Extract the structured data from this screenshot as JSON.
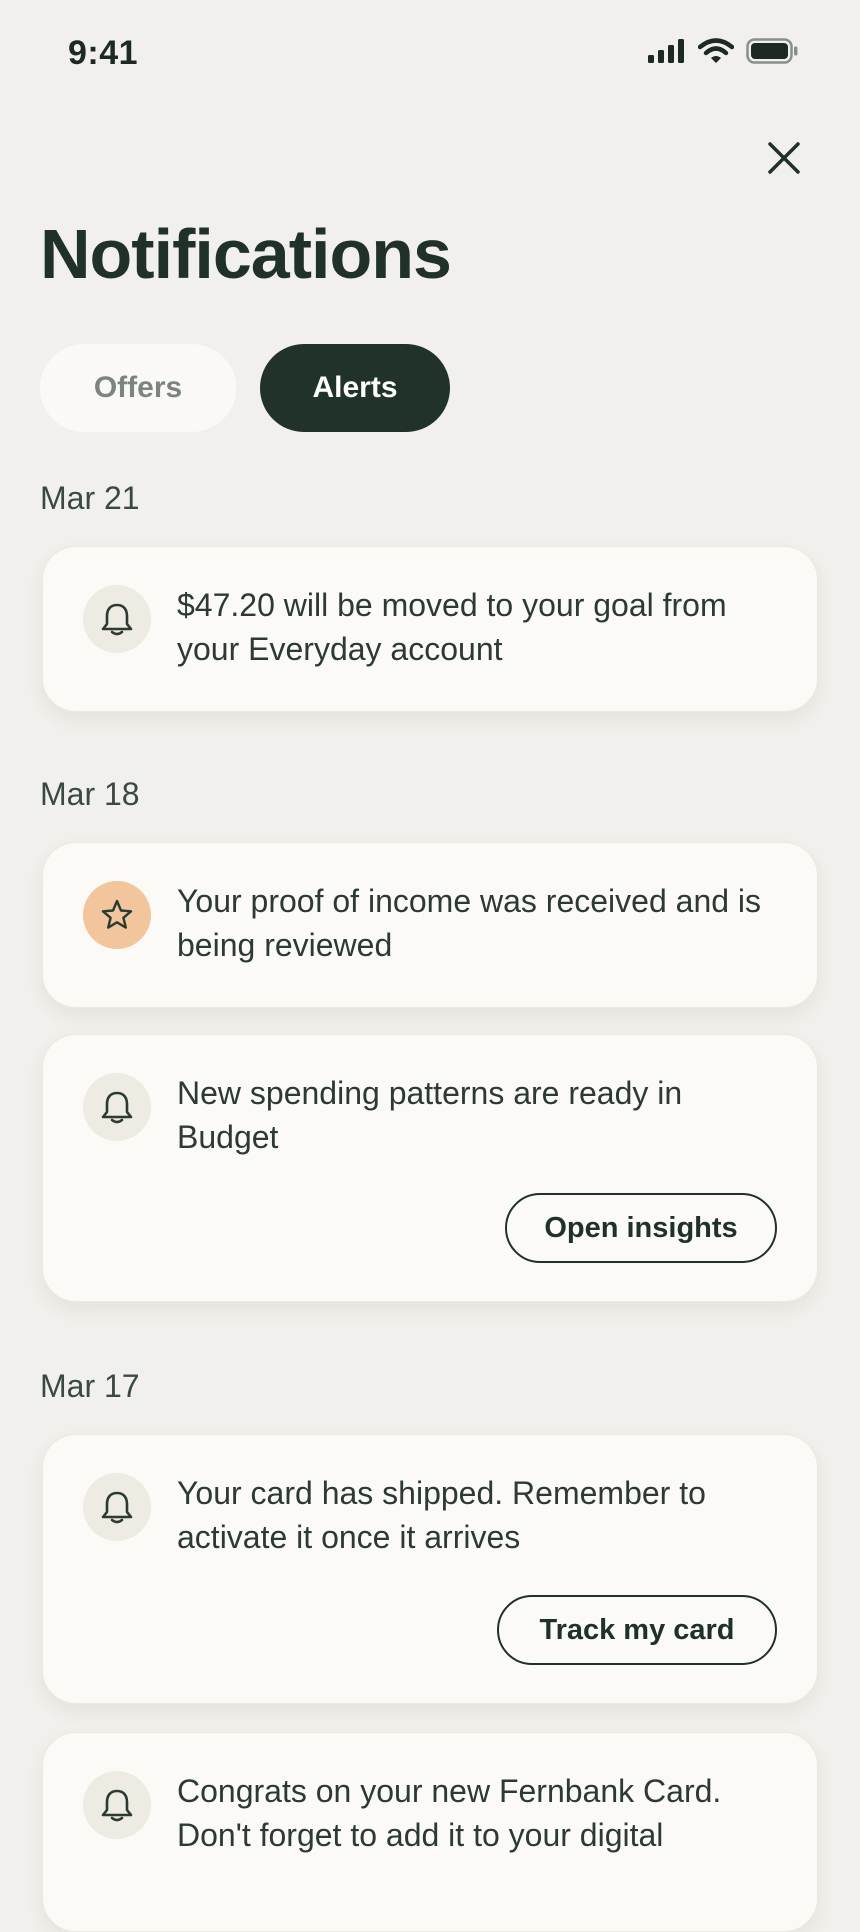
{
  "status_bar": {
    "time": "9:41"
  },
  "header": {
    "title": "Notifications"
  },
  "tabs": [
    {
      "label": "Offers",
      "active": false
    },
    {
      "label": "Alerts",
      "active": true
    }
  ],
  "groups": [
    {
      "date": "Mar 21",
      "items": [
        {
          "icon": "bell-icon",
          "text": "$47.20 will be moved to your goal from your Everyday account"
        }
      ]
    },
    {
      "date": "Mar 18",
      "items": [
        {
          "icon": "star-icon",
          "text": "Your proof of income was received and is being reviewed"
        },
        {
          "icon": "bell-icon",
          "text": "New spending patterns are ready in Budget",
          "button": "Open insights"
        }
      ]
    },
    {
      "date": "Mar 17",
      "items": [
        {
          "icon": "bell-icon",
          "text": "Your card has shipped. Remember to activate it once it arrives",
          "button": "Track my card"
        },
        {
          "icon": "bell-icon",
          "text": "Congrats on your new Fernbank Card. Don't forget to add it to your digital"
        }
      ]
    }
  ],
  "colors": {
    "background": "#F2F0EC",
    "primary": "#213228",
    "card": "#FBFAF7",
    "star_badge": "#F2C59C"
  }
}
